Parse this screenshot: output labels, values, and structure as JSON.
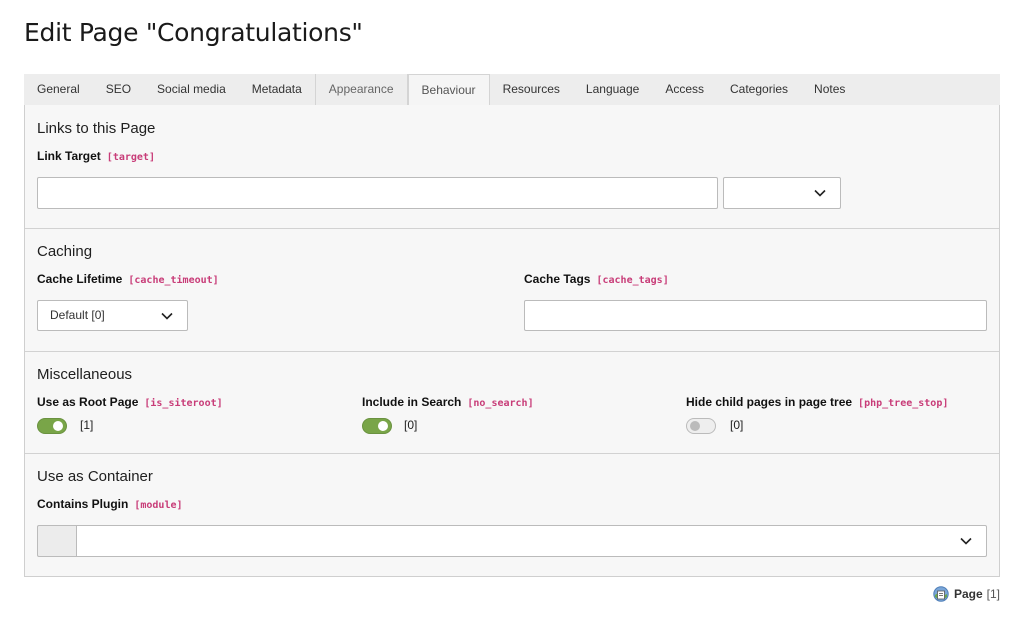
{
  "page": {
    "title": "Edit Page \"Congratulations\""
  },
  "tabs": [
    "General",
    "SEO",
    "Social media",
    "Metadata",
    "Appearance",
    "Behaviour",
    "Resources",
    "Language",
    "Access",
    "Categories",
    "Notes"
  ],
  "active_tab": "Behaviour",
  "sections": {
    "links": {
      "title": "Links to this Page",
      "link_target": {
        "label": "Link Target",
        "field": "[target]",
        "value": "",
        "select_value": ""
      }
    },
    "caching": {
      "title": "Caching",
      "cache_lifetime": {
        "label": "Cache Lifetime",
        "field": "[cache_timeout]",
        "value": "Default [0]"
      },
      "cache_tags": {
        "label": "Cache Tags",
        "field": "[cache_tags]",
        "value": ""
      }
    },
    "misc": {
      "title": "Miscellaneous",
      "root_page": {
        "label": "Use as Root Page",
        "field": "[is_siteroot]",
        "state": true,
        "value": "[1]"
      },
      "in_search": {
        "label": "Include in Search",
        "field": "[no_search]",
        "state": true,
        "value": "[0]"
      },
      "hide_children": {
        "label": "Hide child pages in page tree",
        "field": "[php_tree_stop]",
        "state": false,
        "value": "[0]"
      }
    },
    "container": {
      "title": "Use as Container",
      "plugin": {
        "label": "Contains Plugin",
        "field": "[module]",
        "value": ""
      }
    }
  },
  "footer": {
    "icon": "page-icon",
    "label": "Page",
    "id": "[1]"
  },
  "colors": {
    "toggle_on": "#79a548",
    "code_label": "#c83c78",
    "panel_bg": "#f7f7f7",
    "tab_bar": "#ededed"
  }
}
